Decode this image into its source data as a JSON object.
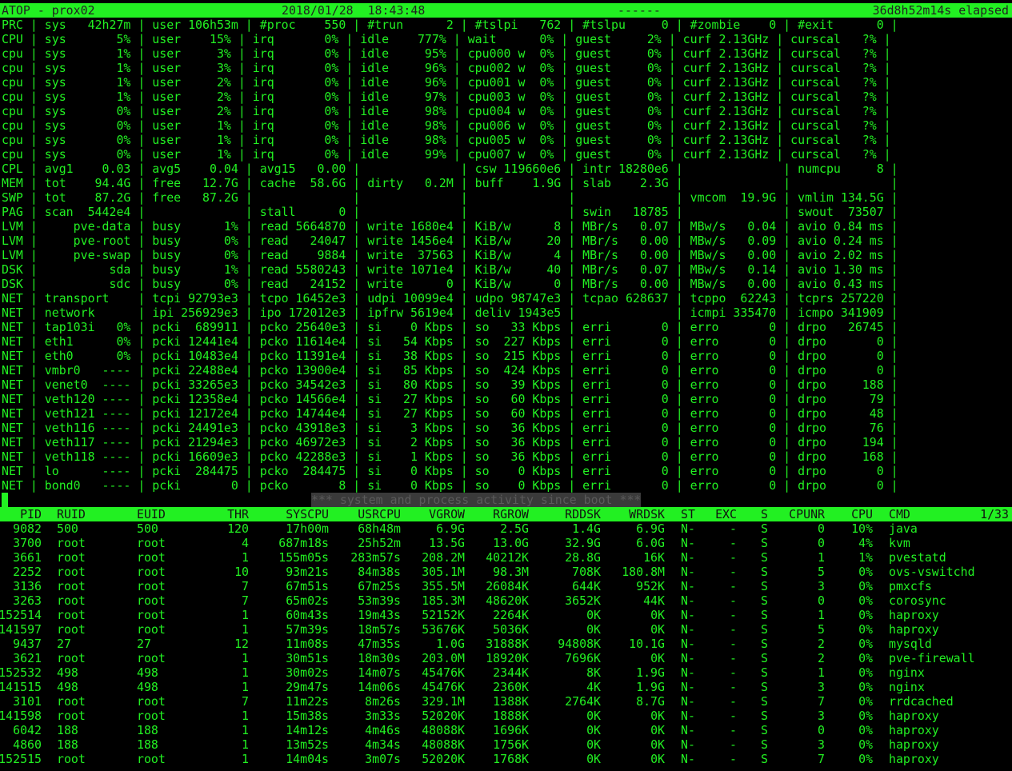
{
  "title": {
    "app": "ATOP - prox02",
    "datetime": "2018/01/28  18:43:48",
    "dashes": "------",
    "elapsed": "36d8h52m14s elapsed"
  },
  "sys_lines": [
    "PRC | sys   42h27m | user 106h53m | #proc    550 | #trun      2 | #tslpi   762 | #tslpu     0 | #zombie    0 | #exit      0 |",
    "CPU | sys       5% | user    15% | irq       0% | idle    777% | wait      0% | guest     2% | curf 2.13GHz | curscal   ?% |",
    "cpu | sys       1% | user     3% | irq       0% | idle     95% | cpu000 w  0% | guest     0% | curf 2.13GHz | curscal   ?% |",
    "cpu | sys       1% | user     3% | irq       0% | idle     96% | cpu002 w  0% | guest     0% | curf 2.13GHz | curscal   ?% |",
    "cpu | sys       1% | user     2% | irq       0% | idle     96% | cpu001 w  0% | guest     0% | curf 2.13GHz | curscal   ?% |",
    "cpu | sys       1% | user     2% | irq       0% | idle     97% | cpu003 w  0% | guest     0% | curf 2.13GHz | curscal   ?% |",
    "cpu | sys       0% | user     2% | irq       0% | idle     98% | cpu004 w  0% | guest     0% | curf 2.13GHz | curscal   ?% |",
    "cpu | sys       0% | user     1% | irq       0% | idle     98% | cpu006 w  0% | guest     0% | curf 2.13GHz | curscal   ?% |",
    "cpu | sys       0% | user     1% | irq       0% | idle     98% | cpu005 w  0% | guest     0% | curf 2.13GHz | curscal   ?% |",
    "cpu | sys       0% | user     1% | irq       0% | idle     99% | cpu007 w  0% | guest     0% | curf 2.13GHz | curscal   ?% |",
    "CPL | avg1    0.03 | avg5    0.04 | avg15   0.00 |              | csw 119660e6 | intr 18280e6 |              | numcpu     8 |",
    "MEM | tot    94.4G | free   12.7G | cache  58.6G | dirty   0.2M | buff    1.9G | slab    2.3G |              |              |",
    "SWP | tot    87.2G | free   87.2G |              |              |              |              | vmcom  19.9G | vmlim 134.5G |",
    "PAG | scan  5442e4 |              | stall      0 |              |              | swin   18785 |              | swout  73507 |",
    "LVM |     pve-data | busy      1% | read 5664870 | write 1680e4 | KiB/w      8 | MBr/s   0.07 | MBw/s   0.04 | avio 0.84 ms |",
    "LVM |     pve-root | busy      0% | read   24047 | write 1456e4 | KiB/w     20 | MBr/s   0.00 | MBw/s   0.09 | avio 0.24 ms |",
    "LVM |     pve-swap | busy      0% | read    9884 | write  37563 | KiB/w      4 | MBr/s   0.00 | MBw/s   0.00 | avio 2.02 ms |",
    "DSK |          sda | busy      1% | read 5580243 | write 1071e4 | KiB/w     40 | MBr/s   0.07 | MBw/s   0.14 | avio 1.30 ms |",
    "DSK |          sdc | busy      0% | read   24152 | write      0 | KiB/w      0 | MBr/s   0.00 | MBw/s   0.00 | avio 0.43 ms |",
    "NET | transport    | tcpi 92793e3 | tcpo 16452e3 | udpi 10099e4 | udpo 98747e3 | tcpao 628637 | tcppo  62243 | tcprs 257220 |",
    "NET | network      | ipi 256929e3 | ipo 172012e3 | ipfrw 5619e4 | deliv 1943e5 |              | icmpi 335470 | icmpo 341909 |",
    "NET | tap103i   0% | pcki  689911 | pcko 25640e3 | si    0 Kbps | so   33 Kbps | erri       0 | erro       0 | drpo   26745 |",
    "NET | eth1      0% | pcki 12441e4 | pcko 11614e4 | si   54 Kbps | so  227 Kbps | erri       0 | erro       0 | drpo       0 |",
    "NET | eth0      0% | pcki 10483e4 | pcko 11391e4 | si   38 Kbps | so  215 Kbps | erri       0 | erro       0 | drpo       0 |",
    "NET | vmbr0   ---- | pcki 22488e4 | pcko 13900e4 | si   85 Kbps | so  424 Kbps | erri       0 | erro       0 | drpo       0 |",
    "NET | venet0  ---- | pcki 33265e3 | pcko 34542e3 | si   80 Kbps | so   39 Kbps | erri       0 | erro       0 | drpo     188 |",
    "NET | veth120 ---- | pcki 12358e4 | pcko 14566e4 | si   27 Kbps | so   60 Kbps | erri       0 | erro       0 | drpo      79 |",
    "NET | veth121 ---- | pcki 12172e4 | pcko 14744e4 | si   27 Kbps | so   60 Kbps | erri       0 | erro       0 | drpo      48 |",
    "NET | veth116 ---- | pcki 24491e3 | pcko 43918e3 | si    3 Kbps | so   36 Kbps | erri       0 | erro       0 | drpo      76 |",
    "NET | veth117 ---- | pcki 21294e3 | pcko 46972e3 | si    2 Kbps | so   36 Kbps | erri       0 | erro       0 | drpo     194 |",
    "NET | veth118 ---- | pcki 16609e3 | pcko 42288e3 | si    1 Kbps | so   36 Kbps | erri       0 | erro       0 | drpo     168 |",
    "NET | lo      ---- | pcki  284475 | pcko  284475 | si    0 Kbps | so    0 Kbps | erri       0 | erro       0 | drpo       0 |",
    "NET | bond0   ---- | pcki       0 | pcko       8 | si    0 Kbps | so    0 Kbps | erri       0 | erro       0 | drpo       0 |"
  ],
  "separator_msg": "*** system and process activity since boot ***",
  "proc_header": {
    "pid": "PID",
    "ruid": "RUID",
    "euid": "EUID",
    "thr": "THR",
    "syscpu": "SYSCPU",
    "usrcpu": "USRCPU",
    "vgrow": "VGROW",
    "rgrow": "RGROW",
    "rddsk": "RDDSK",
    "wrdsk": "WRDSK",
    "st": "ST",
    "exc": "EXC",
    "s": "S",
    "cpunr": "CPUNR",
    "cpu": "CPU",
    "cmd": "CMD",
    "page": "1/33"
  },
  "processes": [
    {
      "pid": "9082",
      "ruid": "500",
      "euid": "500",
      "thr": "120",
      "syscpu": "17h00m",
      "usrcpu": "68h48m",
      "vgrow": "6.9G",
      "rgrow": "2.5G",
      "rddsk": "1.4G",
      "wrdsk": "6.9G",
      "st": "N-",
      "exc": "-",
      "s": "S",
      "cpunr": "0",
      "cpu": "10%",
      "cmd": "java"
    },
    {
      "pid": "3700",
      "ruid": "root",
      "euid": "root",
      "thr": "4",
      "syscpu": "687m18s",
      "usrcpu": "25h52m",
      "vgrow": "13.5G",
      "rgrow": "13.0G",
      "rddsk": "32.9G",
      "wrdsk": "6.0G",
      "st": "N-",
      "exc": "-",
      "s": "S",
      "cpunr": "0",
      "cpu": "4%",
      "cmd": "kvm"
    },
    {
      "pid": "3661",
      "ruid": "root",
      "euid": "root",
      "thr": "1",
      "syscpu": "155m05s",
      "usrcpu": "283m57s",
      "vgrow": "208.2M",
      "rgrow": "40212K",
      "rddsk": "28.8G",
      "wrdsk": "16K",
      "st": "N-",
      "exc": "-",
      "s": "S",
      "cpunr": "1",
      "cpu": "1%",
      "cmd": "pvestatd"
    },
    {
      "pid": "2252",
      "ruid": "root",
      "euid": "root",
      "thr": "10",
      "syscpu": "93m21s",
      "usrcpu": "84m38s",
      "vgrow": "305.1M",
      "rgrow": "98.3M",
      "rddsk": "708K",
      "wrdsk": "180.8M",
      "st": "N-",
      "exc": "-",
      "s": "S",
      "cpunr": "5",
      "cpu": "0%",
      "cmd": "ovs-vswitchd"
    },
    {
      "pid": "3136",
      "ruid": "root",
      "euid": "root",
      "thr": "7",
      "syscpu": "67m51s",
      "usrcpu": "67m25s",
      "vgrow": "355.5M",
      "rgrow": "26084K",
      "rddsk": "644K",
      "wrdsk": "952K",
      "st": "N-",
      "exc": "-",
      "s": "S",
      "cpunr": "3",
      "cpu": "0%",
      "cmd": "pmxcfs"
    },
    {
      "pid": "3263",
      "ruid": "root",
      "euid": "root",
      "thr": "7",
      "syscpu": "65m02s",
      "usrcpu": "53m39s",
      "vgrow": "185.3M",
      "rgrow": "48620K",
      "rddsk": "3652K",
      "wrdsk": "44K",
      "st": "N-",
      "exc": "-",
      "s": "S",
      "cpunr": "0",
      "cpu": "0%",
      "cmd": "corosync"
    },
    {
      "pid": "152514",
      "ruid": "root",
      "euid": "root",
      "thr": "1",
      "syscpu": "60m43s",
      "usrcpu": "19m43s",
      "vgrow": "52152K",
      "rgrow": "2264K",
      "rddsk": "0K",
      "wrdsk": "0K",
      "st": "N-",
      "exc": "-",
      "s": "S",
      "cpunr": "1",
      "cpu": "0%",
      "cmd": "haproxy"
    },
    {
      "pid": "141597",
      "ruid": "root",
      "euid": "root",
      "thr": "1",
      "syscpu": "57m39s",
      "usrcpu": "18m57s",
      "vgrow": "53676K",
      "rgrow": "5036K",
      "rddsk": "0K",
      "wrdsk": "0K",
      "st": "N-",
      "exc": "-",
      "s": "S",
      "cpunr": "5",
      "cpu": "0%",
      "cmd": "haproxy"
    },
    {
      "pid": "9437",
      "ruid": "27",
      "euid": "27",
      "thr": "12",
      "syscpu": "11m08s",
      "usrcpu": "47m35s",
      "vgrow": "1.0G",
      "rgrow": "31888K",
      "rddsk": "94808K",
      "wrdsk": "10.1G",
      "st": "N-",
      "exc": "-",
      "s": "S",
      "cpunr": "2",
      "cpu": "0%",
      "cmd": "mysqld"
    },
    {
      "pid": "3621",
      "ruid": "root",
      "euid": "root",
      "thr": "1",
      "syscpu": "30m51s",
      "usrcpu": "18m30s",
      "vgrow": "203.0M",
      "rgrow": "18920K",
      "rddsk": "7696K",
      "wrdsk": "0K",
      "st": "N-",
      "exc": "-",
      "s": "S",
      "cpunr": "2",
      "cpu": "0%",
      "cmd": "pve-firewall"
    },
    {
      "pid": "152532",
      "ruid": "498",
      "euid": "498",
      "thr": "1",
      "syscpu": "30m02s",
      "usrcpu": "14m07s",
      "vgrow": "45476K",
      "rgrow": "2344K",
      "rddsk": "8K",
      "wrdsk": "1.9G",
      "st": "N-",
      "exc": "-",
      "s": "S",
      "cpunr": "1",
      "cpu": "0%",
      "cmd": "nginx"
    },
    {
      "pid": "141515",
      "ruid": "498",
      "euid": "498",
      "thr": "1",
      "syscpu": "29m47s",
      "usrcpu": "14m06s",
      "vgrow": "45476K",
      "rgrow": "2360K",
      "rddsk": "4K",
      "wrdsk": "1.9G",
      "st": "N-",
      "exc": "-",
      "s": "S",
      "cpunr": "3",
      "cpu": "0%",
      "cmd": "nginx"
    },
    {
      "pid": "3101",
      "ruid": "root",
      "euid": "root",
      "thr": "7",
      "syscpu": "11m22s",
      "usrcpu": "8m26s",
      "vgrow": "329.1M",
      "rgrow": "1388K",
      "rddsk": "2764K",
      "wrdsk": "8.7G",
      "st": "N-",
      "exc": "-",
      "s": "S",
      "cpunr": "7",
      "cpu": "0%",
      "cmd": "rrdcached"
    },
    {
      "pid": "141598",
      "ruid": "root",
      "euid": "root",
      "thr": "1",
      "syscpu": "15m38s",
      "usrcpu": "3m33s",
      "vgrow": "52020K",
      "rgrow": "1888K",
      "rddsk": "0K",
      "wrdsk": "0K",
      "st": "N-",
      "exc": "-",
      "s": "S",
      "cpunr": "3",
      "cpu": "0%",
      "cmd": "haproxy"
    },
    {
      "pid": "6042",
      "ruid": "188",
      "euid": "188",
      "thr": "1",
      "syscpu": "14m12s",
      "usrcpu": "4m46s",
      "vgrow": "48088K",
      "rgrow": "1696K",
      "rddsk": "0K",
      "wrdsk": "0K",
      "st": "N-",
      "exc": "-",
      "s": "S",
      "cpunr": "0",
      "cpu": "0%",
      "cmd": "haproxy"
    },
    {
      "pid": "4860",
      "ruid": "188",
      "euid": "188",
      "thr": "1",
      "syscpu": "13m52s",
      "usrcpu": "4m34s",
      "vgrow": "48088K",
      "rgrow": "1756K",
      "rddsk": "0K",
      "wrdsk": "0K",
      "st": "N-",
      "exc": "-",
      "s": "S",
      "cpunr": "3",
      "cpu": "0%",
      "cmd": "haproxy"
    },
    {
      "pid": "152515",
      "ruid": "root",
      "euid": "root",
      "thr": "1",
      "syscpu": "14m04s",
      "usrcpu": "3m07s",
      "vgrow": "52020K",
      "rgrow": "1768K",
      "rddsk": "0K",
      "wrdsk": "0K",
      "st": "N-",
      "exc": "-",
      "s": "S",
      "cpunr": "7",
      "cpu": "0%",
      "cmd": "haproxy"
    }
  ]
}
